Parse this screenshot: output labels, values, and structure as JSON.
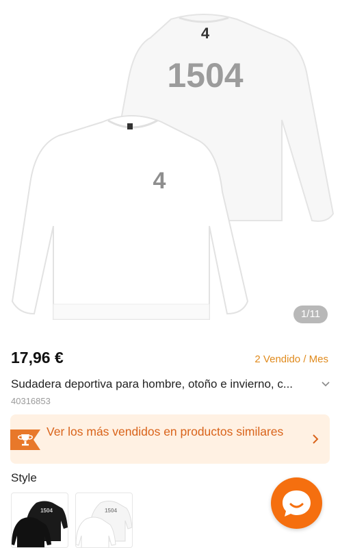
{
  "gallery": {
    "counter": "1/11",
    "print_back": "1504",
    "logo_glyph": "4"
  },
  "product": {
    "price": "17,96 €",
    "sold": "2 Vendido / Mes",
    "title": "Sudadera deportiva para hombre, otoño e invierno, c...",
    "sku": "40316853"
  },
  "banner": {
    "text": "Ver los más vendidos en productos similares",
    "icon": "trophy-icon"
  },
  "style": {
    "label": "Style",
    "options": [
      {
        "name": "black",
        "print": "1504"
      },
      {
        "name": "white",
        "print": "1504"
      }
    ]
  },
  "colors": {
    "accent": "#f56f0f",
    "sold_text": "#e08a1c",
    "banner_bg": "#fff1e3",
    "banner_text": "#d9631a"
  }
}
